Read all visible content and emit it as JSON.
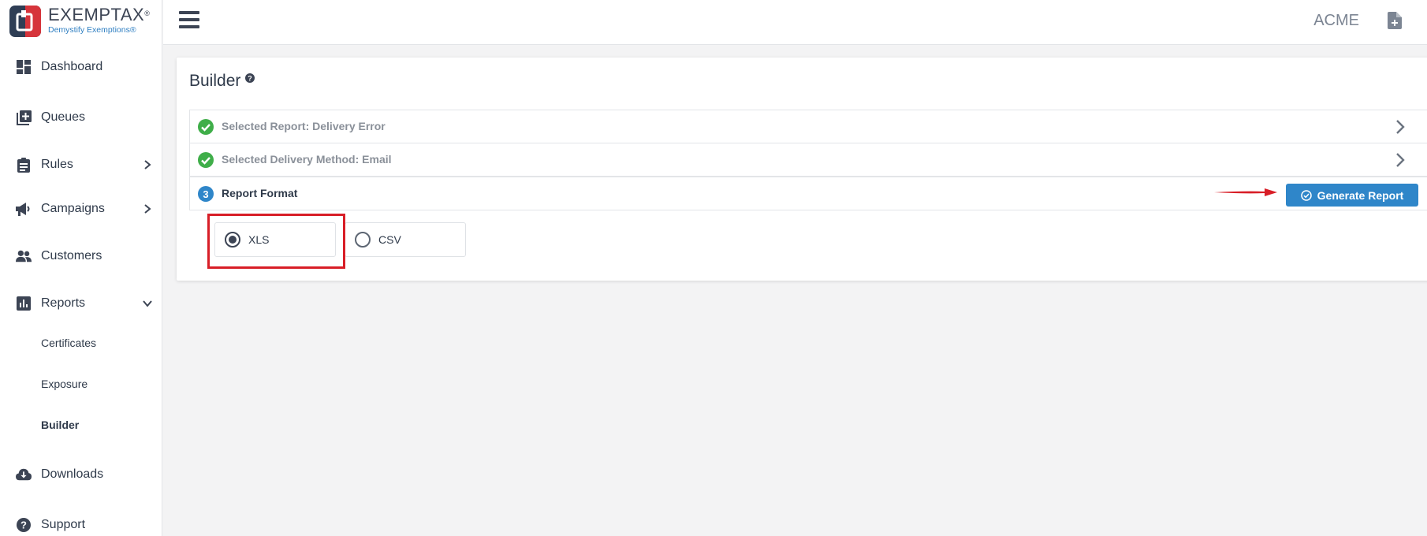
{
  "brand": {
    "name": "EXEMPTAX",
    "registered": "®",
    "tagline": "Demystify Exemptions®"
  },
  "topbar": {
    "company": "ACME"
  },
  "sidebar": {
    "items": [
      {
        "label": "Dashboard",
        "icon": "dashboard-icon"
      },
      {
        "label": "Queues",
        "icon": "queue-add-icon"
      },
      {
        "label": "Rules",
        "icon": "clipboard-icon",
        "expandable": true
      },
      {
        "label": "Campaigns",
        "icon": "megaphone-icon",
        "expandable": true
      },
      {
        "label": "Customers",
        "icon": "people-icon"
      },
      {
        "label": "Reports",
        "icon": "bar-chart-icon",
        "expanded": true
      },
      {
        "label": "Downloads",
        "icon": "cloud-download-icon"
      },
      {
        "label": "Support",
        "icon": "help-circle-icon"
      }
    ],
    "report_subitems": [
      {
        "label": "Certificates"
      },
      {
        "label": "Exposure"
      },
      {
        "label": "Builder",
        "active": true
      }
    ]
  },
  "main": {
    "title": "Builder",
    "steps": [
      {
        "label": "Selected Report: Delivery Error",
        "status": "complete"
      },
      {
        "label": "Selected Delivery Method: Email",
        "status": "complete"
      },
      {
        "label": "Report Format",
        "number": "3",
        "status": "active"
      }
    ],
    "generate_button": "Generate Report",
    "formats": [
      {
        "label": "XLS",
        "selected": true
      },
      {
        "label": "CSV",
        "selected": false
      }
    ]
  },
  "colors": {
    "accent": "#2f86c9",
    "success": "#3fae49",
    "annotation": "#d81e27",
    "brand_red": "#d6343b",
    "brand_navy": "#2f3e55"
  }
}
